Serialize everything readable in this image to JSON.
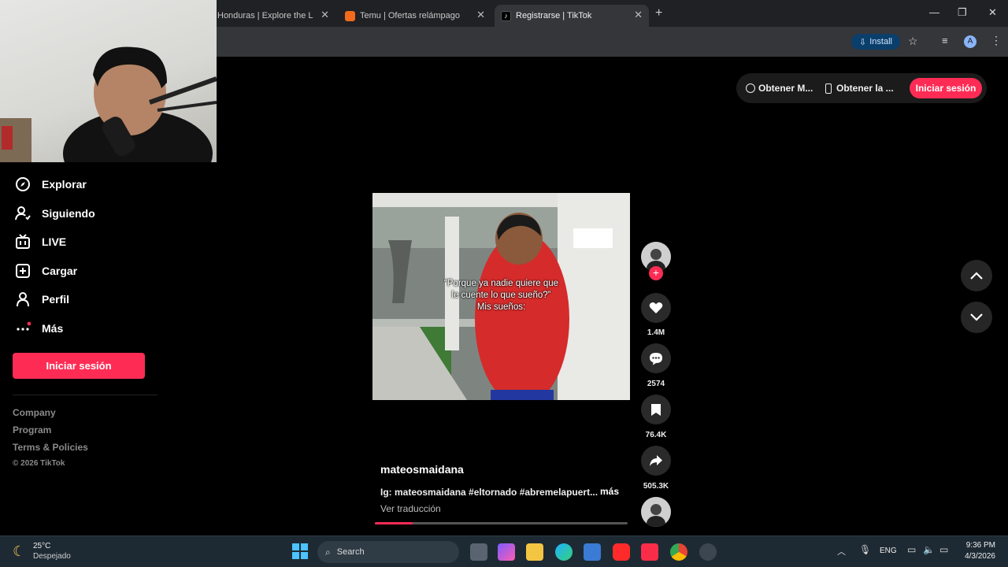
{
  "browser": {
    "tabs": [
      {
        "label": "Honduras | Explore the La",
        "active": false
      },
      {
        "label": "Temu | Ofertas relámpago",
        "active": false
      },
      {
        "label": "Registrarse | TikTok",
        "active": true
      }
    ],
    "install_label": "Install",
    "profile_initial": "A"
  },
  "sidebar": {
    "items": [
      {
        "label": "Explorar",
        "icon": "compass-icon"
      },
      {
        "label": "Siguiendo",
        "icon": "following-icon"
      },
      {
        "label": "LIVE",
        "icon": "live-icon"
      },
      {
        "label": "Cargar",
        "icon": "upload-icon"
      },
      {
        "label": "Perfil",
        "icon": "profile-icon"
      },
      {
        "label": "Más",
        "icon": "more-icon"
      }
    ],
    "login_label": "Iniciar sesión",
    "footer": [
      "Company",
      "Program",
      "Terms & Policies"
    ],
    "copyright": "© 2026 TikTok"
  },
  "topbar": {
    "get_coins": "Obtener M...",
    "get_app": "Obtener la ...",
    "login_label": "Iniciar sesión"
  },
  "video": {
    "caption_lines": [
      "“Porque ya nadie quiere que",
      "le cuente lo que sueño?”",
      "Mis sueños:"
    ],
    "author": "mateosmaidana",
    "description": "Ig: mateosmaidana #eltornado #abremelapuert...",
    "more_label": "más",
    "translate_label": "Ver traducción",
    "progress": 0.15
  },
  "actions": {
    "likes": "1.4M",
    "comments": "2574",
    "saves": "76.4K",
    "shares": "505.3K"
  },
  "taskbar": {
    "weather_temp": "25°C",
    "weather_desc": "Despejado",
    "search_label": "Search",
    "language": "ENG",
    "time": "9:36 PM",
    "date": "4/3/2026"
  }
}
